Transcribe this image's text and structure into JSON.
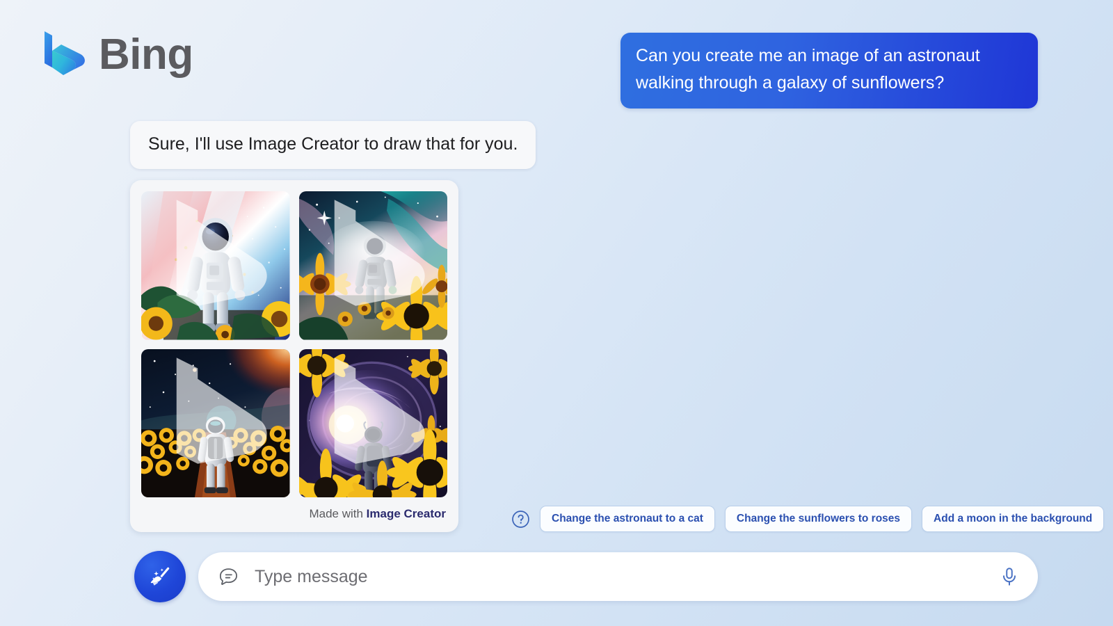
{
  "brand": {
    "name": "Bing",
    "logo_icon": "bing-logo-icon",
    "logo_gradient_start": "#2a7de1",
    "logo_gradient_end": "#3fd2c7"
  },
  "conversation": {
    "user_message": "Can you create me an image of an astronaut walking through a galaxy of sunflowers?",
    "bot_message": "Sure, I'll use Image Creator to draw that for you."
  },
  "image_card": {
    "footer_prefix": "Made with ",
    "footer_brand": "Image Creator",
    "watermark_icon": "bing-watermark-icon",
    "images": [
      {
        "alt": "Astronaut facing forward in a pastel pink and blue nebula with sunflowers and green leaves in the foreground",
        "palette": [
          "#f3b7bd",
          "#ffffff",
          "#9ed6f0",
          "#1e2f8c",
          "#f5c518",
          "#2c6b3a"
        ]
      },
      {
        "alt": "Astronaut walking forward through a teal and pink cosmic nebula framed by large sunflowers",
        "palette": [
          "#1b6f7a",
          "#f2b6d2",
          "#0d1430",
          "#f6bf1d",
          "#123a2c"
        ]
      },
      {
        "alt": "Astronaut seen from behind walking a dirt path through a dense sunflower field under an orange nebula sky",
        "palette": [
          "#0b1430",
          "#e2691f",
          "#f4b91c",
          "#7a2d12",
          "#101a2e"
        ]
      },
      {
        "alt": "Astronaut silhouette walking toward a giant spiral galaxy surrounded by sunflowers",
        "palette": [
          "#2a1a4a",
          "#cfa0e6",
          "#fff1c2",
          "#f5c21b",
          "#15112b"
        ]
      }
    ]
  },
  "suggestions": {
    "help_icon": "question-mark-circle-icon",
    "chips": [
      "Change the astronaut to a cat",
      "Change the sunflowers to roses",
      "Add a moon in the background"
    ]
  },
  "composer": {
    "new_topic_icon": "broom-sparkle-icon",
    "new_topic_color": "#1f46d8",
    "message_icon": "chat-bubble-icon",
    "input_value": "",
    "input_placeholder": "Type message",
    "mic_icon": "microphone-icon",
    "mic_color": "#4a72c4"
  }
}
